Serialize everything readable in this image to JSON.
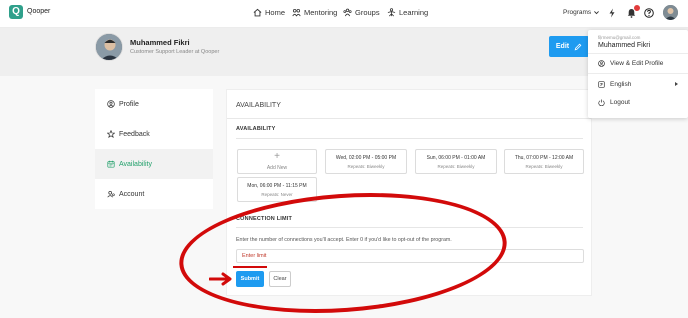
{
  "nav": {
    "brand": "Qooper",
    "logo_letter": "Q",
    "items": [
      {
        "label": "Home",
        "icon": "home-icon"
      },
      {
        "label": "Mentoring",
        "icon": "mentoring-icon"
      },
      {
        "label": "Groups",
        "icon": "groups-icon"
      },
      {
        "label": "Learning",
        "icon": "learning-icon"
      }
    ],
    "programs_label": "Programs"
  },
  "profile": {
    "name": "Muhammed Fikri",
    "role": "Customer Support Leader at Qooper",
    "edit_label": "Edit"
  },
  "sidebar": {
    "items": [
      {
        "label": "Profile",
        "icon": "user-circle-icon"
      },
      {
        "label": "Feedback",
        "icon": "star-icon"
      },
      {
        "label": "Availability",
        "icon": "calendar-icon",
        "active": true
      },
      {
        "label": "Account",
        "icon": "account-icon"
      }
    ]
  },
  "main": {
    "title": "AVAILABILITY",
    "availability_label": "AVAILABILITY",
    "add_new_label": "Add New",
    "slots": [
      {
        "time": "Wed, 02:00 PM - 05:00 PM",
        "repeat": "Repeats: Biweekly"
      },
      {
        "time": "Sun, 06:00 PM - 01:00 AM",
        "repeat": "Repeats: Biweekly"
      },
      {
        "time": "Thu, 07:00 PM - 12:00 AM",
        "repeat": "Repeats: Biweekly"
      },
      {
        "time": "Mon, 06:00 PM - 11:15 PM",
        "repeat": "Repeats: Never"
      }
    ],
    "connection_limit_label": "CONNECTION LIMIT",
    "help_text": "Enter the number of connections you'll accept. Enter 0 if you'd like to opt-out of the program.",
    "input_placeholder": "Enter limit",
    "submit_label": "Submit",
    "clear_label": "Clear"
  },
  "dropdown": {
    "email": "fiḷrmemu@gmail.com",
    "name": "Muhammed Fikri",
    "view_edit_label": "View & Edit Profile",
    "language_label": "English",
    "logout_label": "Logout"
  },
  "colors": {
    "brand_green": "#2fa08b",
    "primary_blue": "#1e9bf0",
    "active_green": "#22a06b",
    "annotation_red": "#d20a0a"
  }
}
